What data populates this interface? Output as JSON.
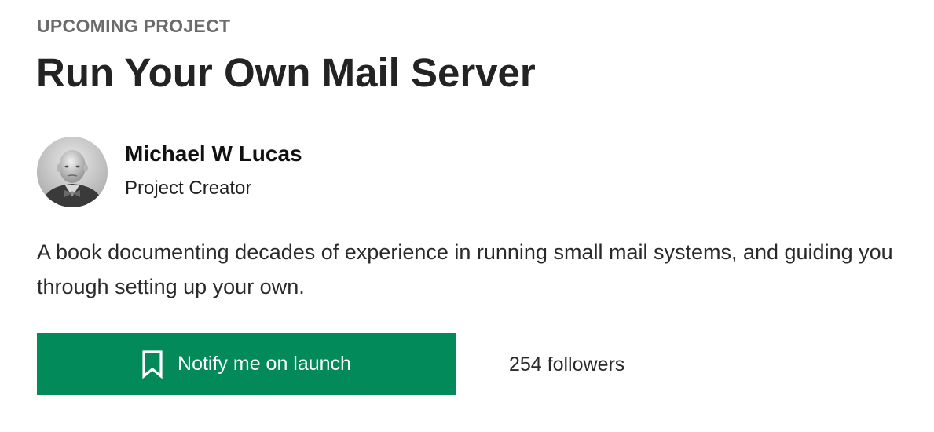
{
  "project": {
    "eyebrow": "UPCOMING PROJECT",
    "title": "Run Your Own Mail Server",
    "description": "A book documenting decades of experience in running small mail systems, and guiding you through setting up your own."
  },
  "creator": {
    "name": "Michael W Lucas",
    "role": "Project Creator",
    "avatar_icon": "person-photo"
  },
  "actions": {
    "notify_label": "Notify me on launch",
    "notify_icon": "bookmark-icon",
    "followers_text": "254 followers"
  },
  "colors": {
    "accent": "#028a5a",
    "eyebrow": "#6b6b6b",
    "title": "#232323"
  }
}
